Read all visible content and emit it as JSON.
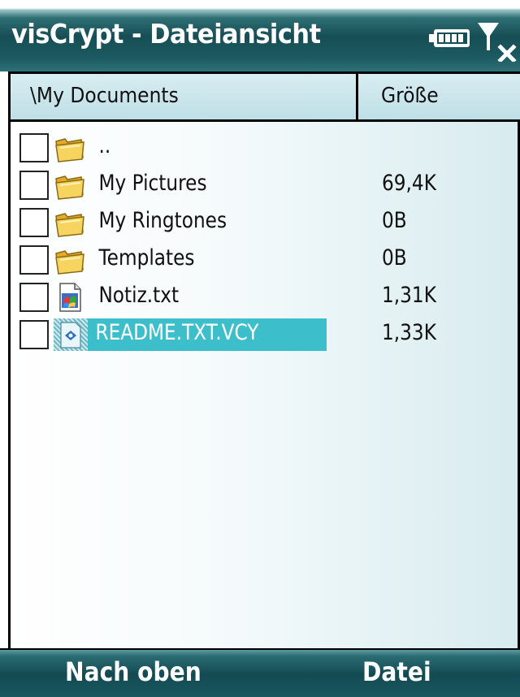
{
  "window": {
    "title": "visCrypt - Dateiansicht"
  },
  "status_icons": {
    "battery": "battery-icon",
    "signal": "signal-no-service-icon"
  },
  "columns": {
    "name": "\\My Documents",
    "size": "Größe"
  },
  "files": [
    {
      "name": "..",
      "size": "",
      "icon": "folder-icon",
      "selected": false
    },
    {
      "name": "My Pictures",
      "size": "69,4K",
      "icon": "folder-icon",
      "selected": false
    },
    {
      "name": "My Ringtones",
      "size": "0B",
      "icon": "folder-icon",
      "selected": false
    },
    {
      "name": "Templates",
      "size": "0B",
      "icon": "folder-icon",
      "selected": false
    },
    {
      "name": "Notiz.txt",
      "size": "1,31K",
      "icon": "text-document-icon",
      "selected": false
    },
    {
      "name": "README.TXT.VCY",
      "size": "1,33K",
      "icon": "encrypted-file-icon",
      "selected": true
    }
  ],
  "softkeys": {
    "left": "Nach oben",
    "right": "Datei"
  },
  "colors": {
    "titlebar": "#174e55",
    "header": "#bedfe6",
    "selection": "#3cbfcb",
    "folder": "#f3c43a"
  }
}
